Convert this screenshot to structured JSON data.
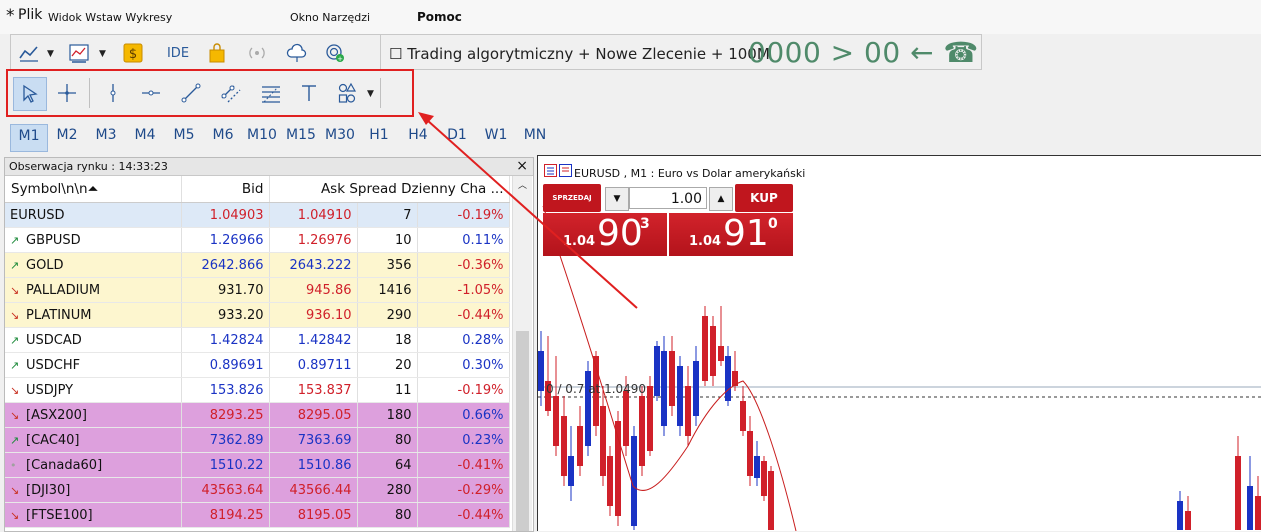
{
  "menu": {
    "star": "*",
    "plik": "Plik",
    "items1": "Widok Wstaw Wykresy",
    "okno": "Okno Narzędzi",
    "pomoc": "Pomoc"
  },
  "toolbar": {
    "ide": "IDE",
    "algo_text": "☐ Trading algorytmiczny + Nowe Zlecenie + 100M",
    "algo_big": "0000 > 00 ← ☎"
  },
  "timeframes": [
    "M1",
    "M2",
    "M3",
    "M4",
    "M5",
    "M6",
    "M10",
    "M15",
    "M30",
    "H1",
    "H4",
    "D1",
    "W1",
    "MN"
  ],
  "market_watch": {
    "title": "Obserwacja rynku : 14:33:23",
    "close": "×",
    "columns": [
      "Symbol\\n\\n⏶",
      "Bid",
      "Ask",
      "Spread",
      "Dzienny Cha ..."
    ],
    "header_symbol": "Symbol\\n\\n⏶",
    "header_bid": "Bid",
    "header_rest": "Ask Spread Dzienny Cha ...",
    "rows": [
      {
        "symbol": "EURUSD",
        "icon": "",
        "bid": "1.04903",
        "ask": "1.04910",
        "spread": "7",
        "change": "-0.19%"
      },
      {
        "symbol": "GBPUSD",
        "icon": "↗",
        "bid": "1.26966",
        "ask": "1.26976",
        "spread": "10",
        "change": "0.11%"
      },
      {
        "symbol": "GOLD",
        "icon": "↗",
        "bid": "2642.866",
        "ask": "2643.222",
        "spread": "356",
        "change": "-0.36%"
      },
      {
        "symbol": "PALLADIUM",
        "icon": "↘",
        "bid": "931.70",
        "ask": "945.86",
        "spread": "1416",
        "change": "-1.05%"
      },
      {
        "symbol": "PLATINUM",
        "icon": "↘",
        "bid": "933.20",
        "ask": "936.10",
        "spread": "290",
        "change": "-0.44%"
      },
      {
        "symbol": "USDCAD",
        "icon": "↗",
        "bid": "1.42824",
        "ask": "1.42842",
        "spread": "18",
        "change": "0.28%"
      },
      {
        "symbol": "USDCHF",
        "icon": "↗",
        "bid": "0.89691",
        "ask": "0.89711",
        "spread": "20",
        "change": "0.30%"
      },
      {
        "symbol": "USDJPY",
        "icon": "↘",
        "bid": "153.826",
        "ask": "153.837",
        "spread": "11",
        "change": "-0.19%"
      },
      {
        "symbol": "[ASX200]",
        "icon": "↘",
        "bid": "8293.25",
        "ask": "8295.05",
        "spread": "180",
        "change": "0.66%"
      },
      {
        "symbol": "[CAC40]",
        "icon": "↗",
        "bid": "7362.89",
        "ask": "7363.69",
        "spread": "80",
        "change": "0.23%"
      },
      {
        "symbol": "[Canada60]",
        "icon": "•",
        "bid": "1510.22",
        "ask": "1510.86",
        "spread": "64",
        "change": "-0.41%"
      },
      {
        "symbol": "[DJI30]",
        "icon": "↘",
        "bid": "43563.64",
        "ask": "43566.44",
        "spread": "280",
        "change": "-0.29%"
      },
      {
        "symbol": "[FTSE100]",
        "icon": "↘",
        "bid": "8194.25",
        "ask": "8195.05",
        "spread": "80",
        "change": "-0.44%"
      }
    ]
  },
  "chart": {
    "title": "EURUSD , M1 : Euro vs Dolar amerykański",
    "level_label": "0 / 0.7 at 1.0490",
    "sell_label": "SPRZEDAJ",
    "buy_label": "KUP",
    "volume": "1.00",
    "sell_prefix": "1.04",
    "sell_big": "90",
    "sell_sup": "3",
    "buy_prefix": "1.04",
    "buy_big": "91",
    "buy_sup": "0"
  },
  "colors": {
    "bull": "#1a33c4",
    "bear": "#d0202a",
    "highlight": "#e02020",
    "row_yellow": "#fdf6cf",
    "row_purple": "#dda0dd",
    "row_blue": "#dde9f7"
  }
}
